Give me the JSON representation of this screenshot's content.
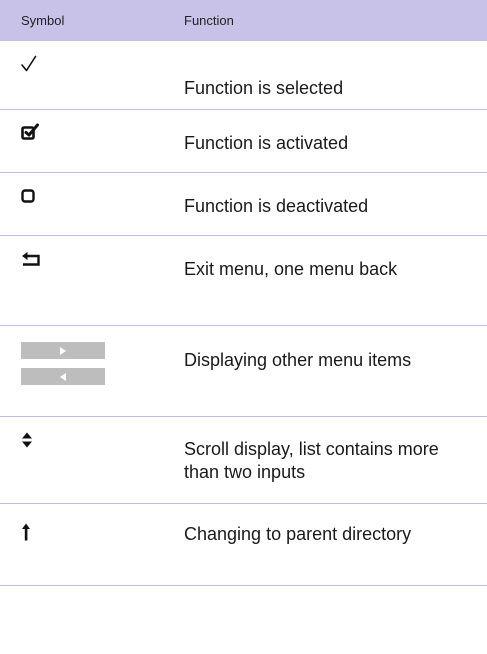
{
  "header": {
    "symbol_label": "Symbol",
    "function_label": "Function"
  },
  "rows": [
    {
      "icon": "checkmark-icon",
      "text": "Function is selected"
    },
    {
      "icon": "checked-box-icon",
      "text": "Function is activated"
    },
    {
      "icon": "empty-box-icon",
      "text": "Function is deactivated"
    },
    {
      "icon": "back-arrow-icon",
      "text": "Exit menu, one menu back"
    },
    {
      "icon": "next-prev-bars-icon",
      "text": "Displaying other menu items"
    },
    {
      "icon": "scroll-up-down-icon",
      "text": "Scroll display, list contains more than two inputs"
    },
    {
      "icon": "parent-directory-arrow-icon",
      "text": "Changing to parent directory"
    }
  ],
  "colors": {
    "header_bg": "#c8c2e8",
    "row_divider": "#c3bde6",
    "gray_bar": "#bdbdbd"
  }
}
